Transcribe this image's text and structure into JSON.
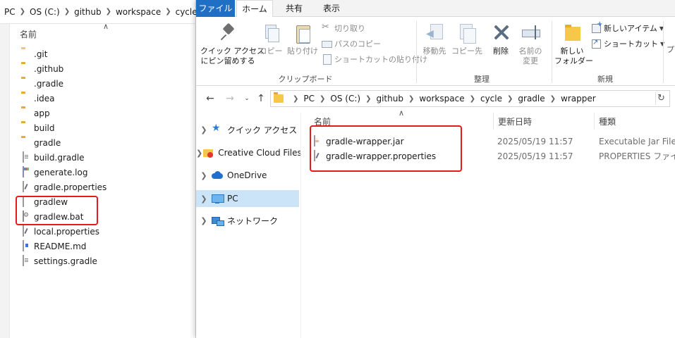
{
  "left_window": {
    "breadcrumb": [
      "PC",
      "OS (C:)",
      "github",
      "workspace",
      "cycle"
    ],
    "column_name": "名前",
    "files": [
      {
        "name": ".git",
        "kind": "folder-dim"
      },
      {
        "name": ".github",
        "kind": "folder"
      },
      {
        "name": ".gradle",
        "kind": "folder"
      },
      {
        "name": ".idea",
        "kind": "folder"
      },
      {
        "name": "app",
        "kind": "folder"
      },
      {
        "name": "build",
        "kind": "folder"
      },
      {
        "name": "gradle",
        "kind": "folder"
      },
      {
        "name": "build.gradle",
        "kind": "gradle"
      },
      {
        "name": "generate.log",
        "kind": "log"
      },
      {
        "name": "gradle.properties",
        "kind": "props"
      },
      {
        "name": "gradlew",
        "kind": "file"
      },
      {
        "name": "gradlew.bat",
        "kind": "bat"
      },
      {
        "name": "local.properties",
        "kind": "props"
      },
      {
        "name": "README.md",
        "kind": "md"
      },
      {
        "name": "settings.gradle",
        "kind": "gradle"
      }
    ]
  },
  "right_window": {
    "tabs": {
      "file": "ファイル",
      "home": "ホーム",
      "share": "共有",
      "view": "表示"
    },
    "ribbon": {
      "pin_quick_access_line1": "クイック アクセス",
      "pin_quick_access_line2": "にピン留めする",
      "copy": "コピー",
      "paste": "貼り付け",
      "cut": "切り取り",
      "copy_path": "パスのコピー",
      "paste_shortcut": "ショートカットの貼り付け",
      "group_clipboard": "クリップボード",
      "move_to": "移動先",
      "copy_to": "コピー先",
      "delete": "削除",
      "rename_line1": "名前の",
      "rename_line2": "変更",
      "group_organize": "整理",
      "new_item": "新しいアイテム",
      "shortcut": "ショートカット",
      "new_folder_line1": "新しい",
      "new_folder_line2": "フォルダー",
      "group_new": "新規",
      "overflow": "プ"
    },
    "address": [
      "PC",
      "OS (C:)",
      "github",
      "workspace",
      "cycle",
      "gradle",
      "wrapper"
    ],
    "nav": [
      {
        "label": "クイック アクセス",
        "icon": "star"
      },
      {
        "label": "Creative Cloud Files",
        "icon": "cc"
      },
      {
        "label": "OneDrive",
        "icon": "cloud"
      },
      {
        "label": "PC",
        "icon": "pc",
        "selected": true
      },
      {
        "label": "ネットワーク",
        "icon": "network"
      }
    ],
    "columns": {
      "name": "名前",
      "date": "更新日時",
      "type": "種類"
    },
    "files": [
      {
        "name": "gradle-wrapper.jar",
        "date": "2025/05/19 11:57",
        "type": "Executable Jar File",
        "kind": "jar"
      },
      {
        "name": "gradle-wrapper.properties",
        "date": "2025/05/19 11:57",
        "type": "PROPERTIES ファイル",
        "kind": "props"
      }
    ]
  },
  "colors": {
    "file_tab": "#1f6fc5",
    "selection": "#cce4f7",
    "highlight_box": "#e51b1b",
    "folder": "#f6c84a"
  }
}
